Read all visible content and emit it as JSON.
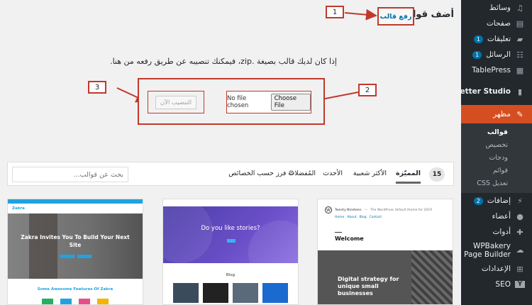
{
  "sidebar": {
    "items": [
      {
        "label": "وسائط",
        "icon": "media-icon"
      },
      {
        "label": "صفحات",
        "icon": "pages-icon"
      },
      {
        "label": "تعليقات",
        "icon": "comments-icon",
        "badge": "1"
      },
      {
        "label": "الرسائل",
        "icon": "messages-icon",
        "badge": "1"
      },
      {
        "label": "TablePress",
        "icon": "table-icon"
      },
      {
        "label": "Better Studio",
        "icon": "betterstudio-icon"
      },
      {
        "label": "مظهر",
        "icon": "appearance-icon",
        "active": true
      },
      {
        "label": "إضافات",
        "icon": "plugins-icon",
        "badge": "2"
      },
      {
        "label": "أعضاء",
        "icon": "users-icon"
      },
      {
        "label": "أدوات",
        "icon": "tools-icon"
      },
      {
        "label": "WPBakery Page Builder",
        "icon": "wpbakery-icon"
      },
      {
        "label": "الإعدادات",
        "icon": "settings-icon"
      },
      {
        "label": "SEO",
        "icon": "yoast-icon"
      }
    ],
    "subitems": [
      "قوالب",
      "تخصيص",
      "ودجات",
      "قوائم",
      "تعديل CSS"
    ]
  },
  "header": {
    "title": "أضف قوالب",
    "upload_button": "رفع قالب"
  },
  "callouts": [
    "1",
    "2",
    "3"
  ],
  "upload": {
    "info_text": "إذا كان لديك قالب بصيغة .zip، فيمكنك تنصيبه عن طريق رفعه من هنا.",
    "no_file_text": "No file chosen",
    "choose_file_label": "Choose File",
    "install_label": "التنصيب الآن"
  },
  "filter": {
    "count": "15",
    "tabs": [
      "المميّزة",
      "الأكثر شعبية",
      "الأحدث",
      "المُفضلات",
      "فرز حسب الخصائص"
    ],
    "search_placeholder": "بحث عن قوالب..."
  },
  "themes": [
    {
      "heading": "Zakra Invites You To Build Your Next Site",
      "subheading": "Some Awesome Features Of Zakra",
      "brand": "Zakra"
    },
    {
      "heading": "Do you like stories?",
      "section": "Blog"
    },
    {
      "site_title": "Twenty Nineteen",
      "tagline": "The WordPress default theme for 2019",
      "nav": [
        "Home",
        "About",
        "Blog",
        "Contact"
      ],
      "welcome": "Welcome",
      "hero": "Digital strategy for unique small businesses"
    }
  ],
  "colors": {
    "sidebar_bg": "#23282d",
    "active": "#d54e21",
    "accent": "#0073aa",
    "callout": "#c0392b"
  }
}
